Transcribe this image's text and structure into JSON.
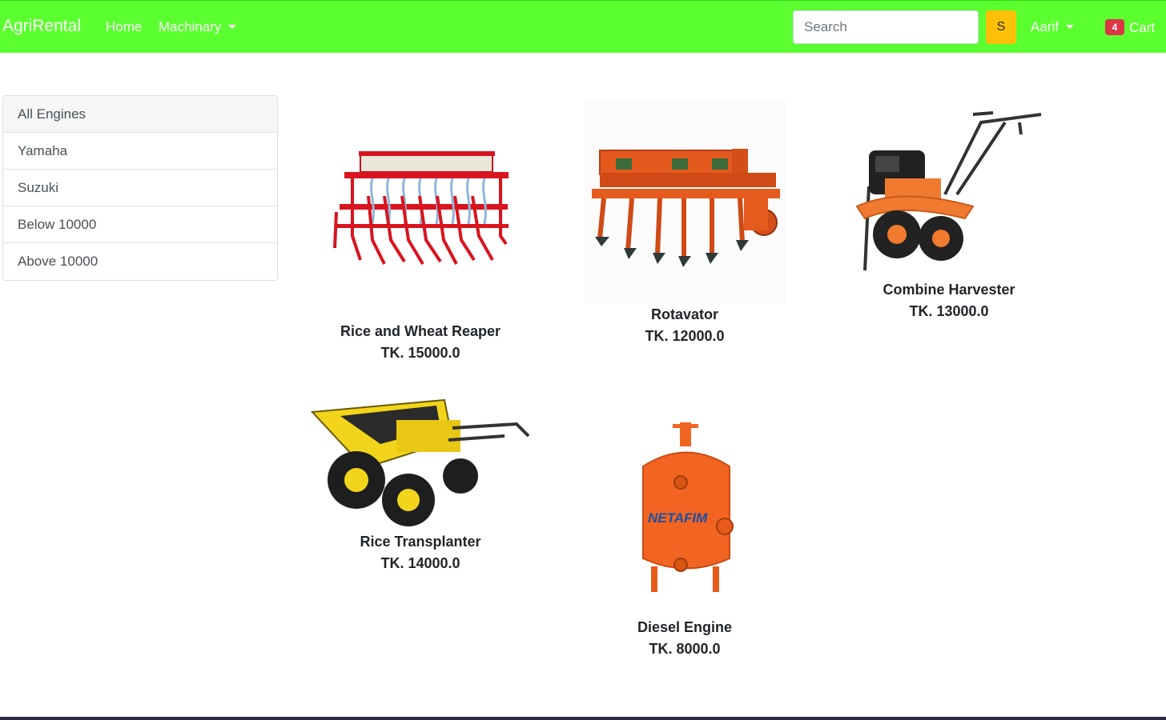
{
  "navbar": {
    "brand": "AgriRental",
    "home": "Home",
    "machinary": "Machinary",
    "search_placeholder": "Search",
    "search_button": "S",
    "user": "Aarif",
    "cart_count": "4",
    "cart_label": "Cart",
    "bg_color": "#5bff2f"
  },
  "sidebar": {
    "items": [
      {
        "label": "All Engines"
      },
      {
        "label": "Yamaha"
      },
      {
        "label": "Suzuki"
      },
      {
        "label": "Below 10000"
      },
      {
        "label": "Above 10000"
      }
    ]
  },
  "products": [
    {
      "name": "Rice and Wheat Reaper",
      "price": "TK. 15000.0",
      "icon": "seed-drill-image"
    },
    {
      "name": "Rotavator",
      "price": "TK. 12000.0",
      "icon": "rotavator-image"
    },
    {
      "name": "Combine Harvester",
      "price": "TK. 13000.0",
      "icon": "tiller-image"
    },
    {
      "name": "Rice Transplanter",
      "price": "TK. 14000.0",
      "icon": "dumper-image"
    },
    {
      "name": "Diesel Engine",
      "price": "TK. 8000.0",
      "icon": "tank-image"
    }
  ]
}
